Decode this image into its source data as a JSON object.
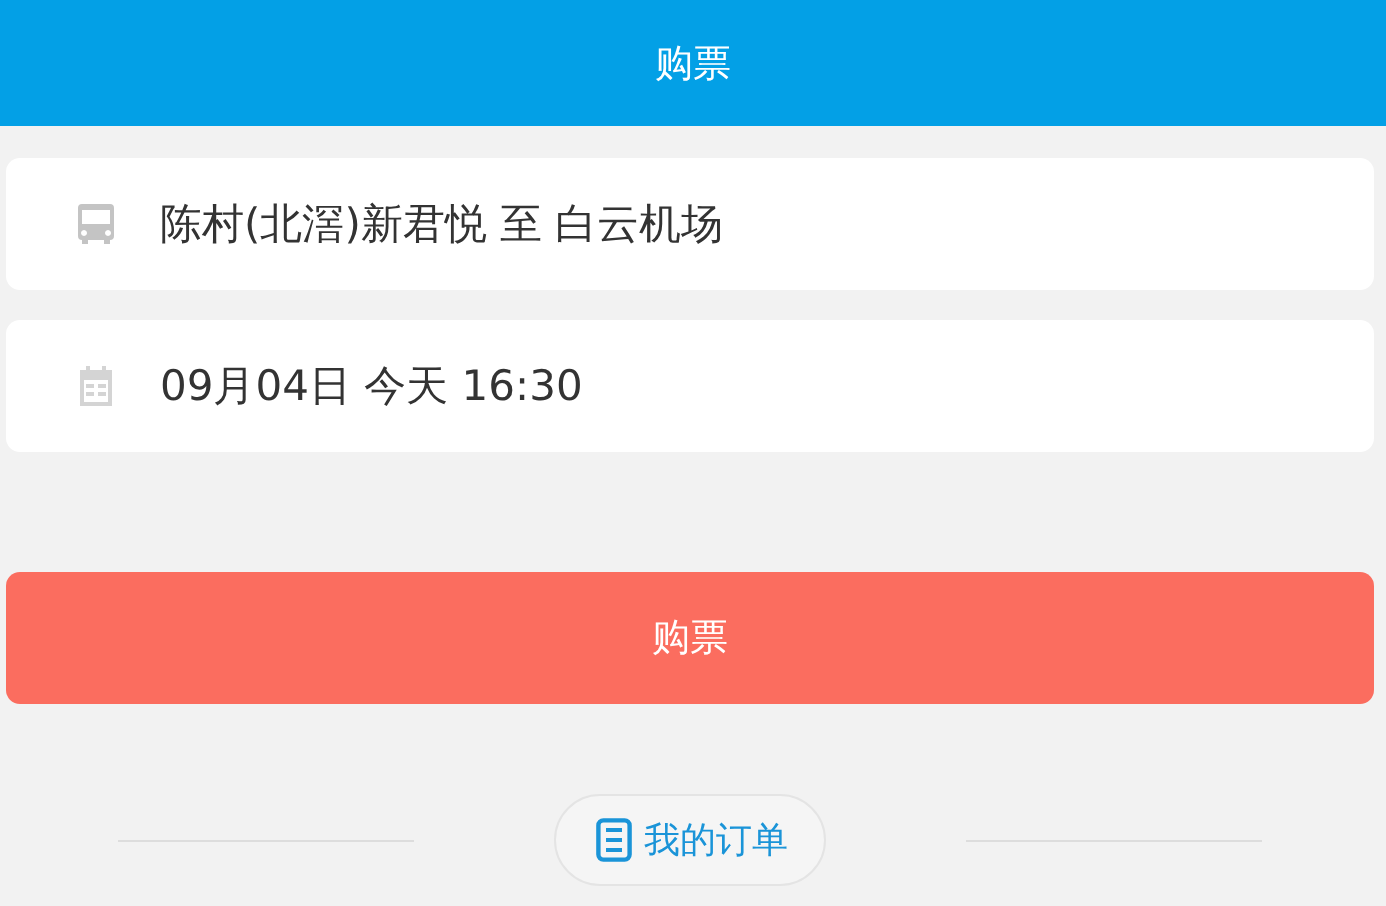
{
  "header": {
    "title": "购票"
  },
  "fields": [
    {
      "kind": "route",
      "value": "陈村(北滘)新君悦 至 白云机场"
    },
    {
      "kind": "date",
      "value": "09月04日 今天 16:30"
    }
  ],
  "buy_button": {
    "label": "购票"
  },
  "orders_link": {
    "label": "我的订单"
  }
}
